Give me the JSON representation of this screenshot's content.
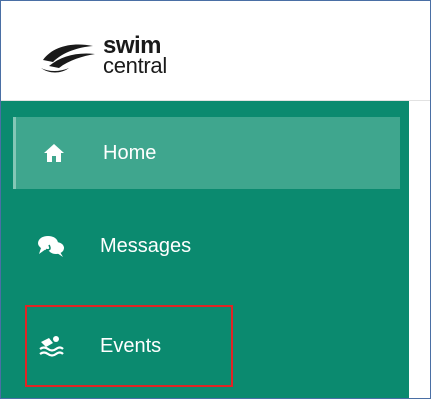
{
  "brand": {
    "line1": "swim",
    "line2": "central",
    "logo_icon": "swimmer-swoosh-icon"
  },
  "nav": {
    "items": [
      {
        "label": "Home",
        "icon": "home-icon",
        "active": true
      },
      {
        "label": "Messages",
        "icon": "chat-bubbles-icon",
        "active": false
      },
      {
        "label": "Events",
        "icon": "swimmer-icon",
        "active": false
      }
    ]
  },
  "colors": {
    "sidebar": "#0b8a6f",
    "active_item": "#3fa68e",
    "highlight": "#e02424"
  }
}
